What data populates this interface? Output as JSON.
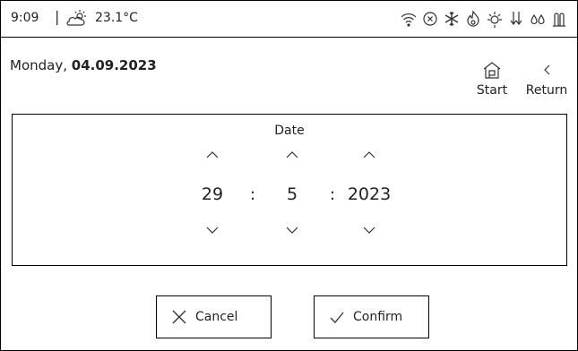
{
  "status": {
    "time": "9:09",
    "separator": "|",
    "temperature": "23.1°C",
    "weather_icon": "sun-cloud-icon",
    "icons": [
      "wifi-icon",
      "error-circle-icon",
      "snowflake-icon",
      "flame-icon",
      "defrost-icon",
      "arrows-down-icon",
      "drops-icon",
      "sensor-icon"
    ]
  },
  "header": {
    "weekday": "Monday, ",
    "date": "04.09.2023",
    "start_label": "Start",
    "return_label": "Return"
  },
  "date_panel": {
    "title": "Date",
    "day": "29",
    "month": "5",
    "year": "2023",
    "colon": ":"
  },
  "actions": {
    "cancel_label": "Cancel",
    "confirm_label": "Confirm"
  }
}
